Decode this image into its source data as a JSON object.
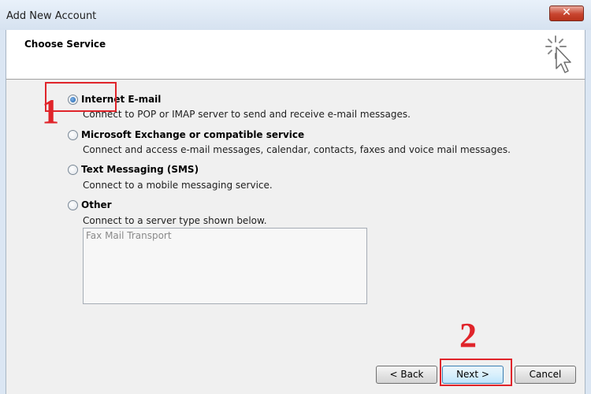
{
  "window": {
    "title": "Add New Account",
    "close_glyph": "✕"
  },
  "header": {
    "title": "Choose Service",
    "icon": "wizard-cursor-icon"
  },
  "options": [
    {
      "label": "Internet E-mail",
      "description": "Connect to POP or IMAP server to send and receive e-mail messages.",
      "checked": true
    },
    {
      "label": "Microsoft Exchange or compatible service",
      "description": "Connect and access e-mail messages, calendar, contacts, faxes and voice mail messages.",
      "checked": false
    },
    {
      "label": "Text Messaging (SMS)",
      "description": "Connect to a mobile messaging service.",
      "checked": false
    },
    {
      "label": "Other",
      "description": "Connect to a server type shown below.",
      "checked": false
    }
  ],
  "other_list": {
    "items": [
      "Fax Mail Transport"
    ]
  },
  "buttons": {
    "back": "< Back",
    "next": "Next >",
    "cancel": "Cancel"
  },
  "annotations": {
    "step1": "1",
    "step2": "2",
    "color": "#e0242a"
  }
}
